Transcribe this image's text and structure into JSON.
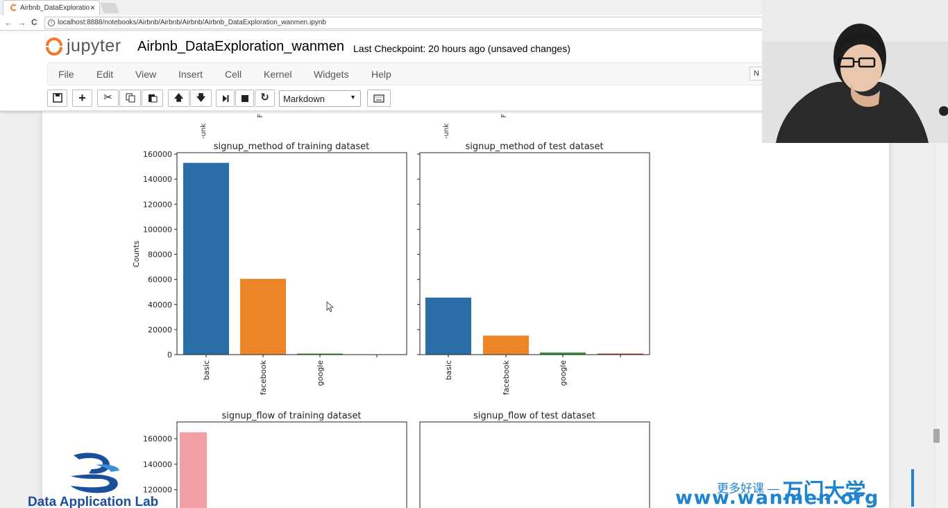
{
  "browser": {
    "tab_title": "Airbnb_DataExploratio",
    "tab_close": "×",
    "url": "localhost:8888/notebooks/Airbnb/Airbnb/Airbnb/Airbnb_DataExploration_wanmen.ipynb",
    "back": "←",
    "forward": "→",
    "reload": "C",
    "info": "i"
  },
  "jupyter": {
    "logo_text": "jupyter",
    "notebook_title": "Airbnb_DataExploration_wanmen",
    "checkpoint": "Last Checkpoint: 20 hours ago (unsaved changes)",
    "menu": [
      "File",
      "Edit",
      "View",
      "Insert",
      "Cell",
      "Kernel",
      "Widgets",
      "Help"
    ],
    "kernel_indicator": "N",
    "cell_type": "Markdown",
    "toolbar_icons": [
      "save-icon",
      "add-cell-icon",
      "cut-icon",
      "copy-icon",
      "paste-icon",
      "move-up-icon",
      "move-down-icon",
      "run-icon",
      "stop-icon",
      "restart-icon",
      "keyboard-icon"
    ]
  },
  "chart_data": [
    {
      "type": "bar",
      "title": "signup_method of training dataset",
      "ylabel": "Counts",
      "categories": [
        "basic",
        "facebook",
        "google",
        ""
      ],
      "values": [
        153000,
        60500,
        200,
        0
      ],
      "colors": [
        "#2a6ea8",
        "#ec8527",
        "#3a913a",
        "#c83a3a"
      ],
      "ylim": [
        0,
        160000
      ],
      "yticks": [
        "0",
        "20000",
        "40000",
        "60000",
        "80000",
        "100000",
        "120000",
        "140000",
        "160000"
      ]
    },
    {
      "type": "bar",
      "title": "signup_method of test dataset",
      "categories": [
        "basic",
        "facebook",
        "google",
        ""
      ],
      "values": [
        45500,
        15200,
        1700,
        300
      ],
      "colors": [
        "#2a6ea8",
        "#ec8527",
        "#3a913a",
        "#c83a3a"
      ],
      "ylim": [
        0,
        160000
      ]
    },
    {
      "type": "bar",
      "title": "signup_flow of training dataset",
      "categories": [
        ""
      ],
      "values": [
        165000
      ],
      "colors": [
        "#f2a0a5"
      ],
      "yticks": [
        "120000",
        "140000",
        "160000"
      ]
    },
    {
      "type": "bar",
      "title": "signup_flow of test dataset",
      "categories": [],
      "values": []
    }
  ],
  "prev_chart_tick_fragments": [
    "-unk",
    "F",
    "-unk",
    "F"
  ],
  "watermarks": {
    "dal": "Data Application Lab",
    "cn_small": "更多好课 —",
    "cn_big": "万门大学",
    "site": "www.wanmen.org"
  }
}
